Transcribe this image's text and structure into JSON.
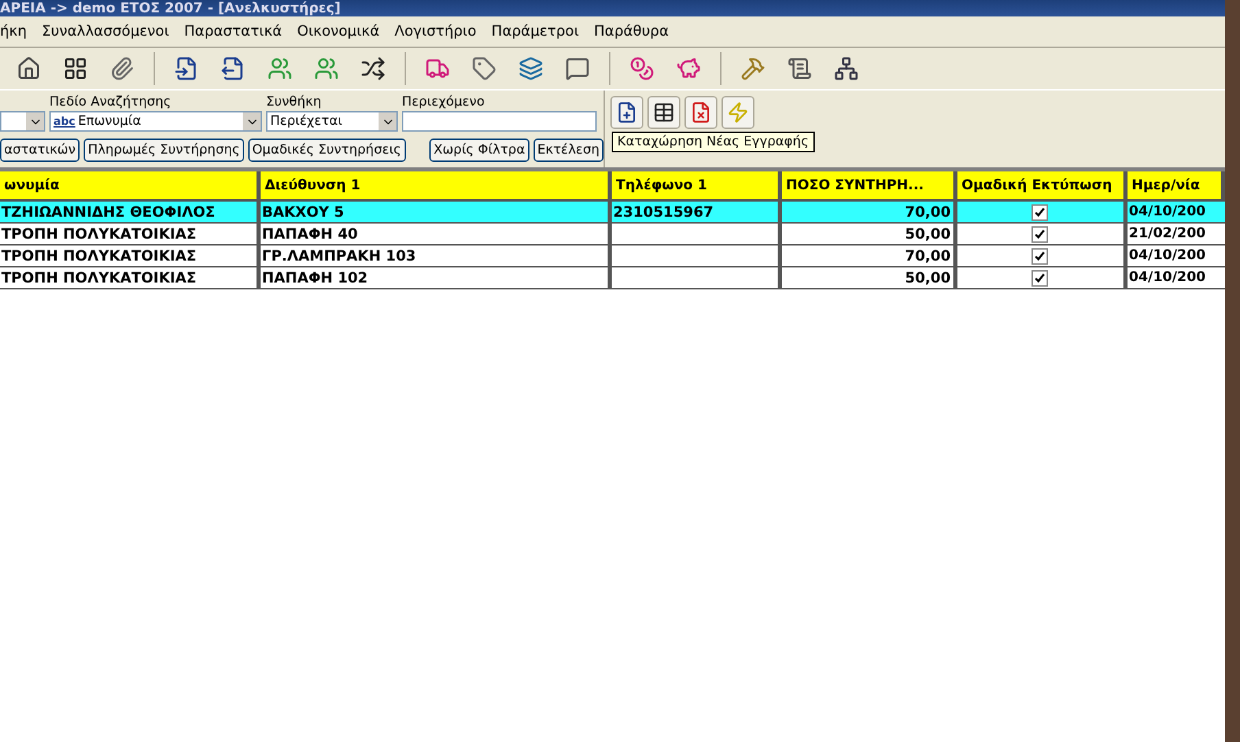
{
  "window": {
    "title": "ΑΡΕΙΑ -> demo ΕΤΟΣ 2007 - [Ανελκυστήρες]"
  },
  "menu": [
    "ήκη",
    "Συναλλασσόμενοι",
    "Παραστατικά",
    "Οικονομικά",
    "Λογιστήριο",
    "Παράμετροι",
    "Παράθυρα"
  ],
  "filter": {
    "field_label": "Πεδίο Αναζήτησης",
    "field_icon_text": "abc",
    "field_value": "Επωνυμία",
    "condition_label": "Συνθήκη",
    "condition_value": "Περιέχεται",
    "content_label": "Περιεχόμενο",
    "buttons": [
      "αστατικών",
      "Πληρωμές Συντήρησης",
      "Ομαδικές Συντηρήσεις"
    ],
    "clear_button": "Χωρίς Φίλτρα",
    "run_button": "Εκτέλεση"
  },
  "tooltip": "Καταχώρηση Νέας Εγγραφής",
  "table": {
    "columns": [
      "ωνυμία",
      "Διεύθυνση 1",
      "Τηλέφωνο 1",
      "ΠΟΣΟ ΣΥΝΤΗΡΗ...",
      "Ομαδική Εκτύπωση",
      "Ημερ/νία"
    ],
    "rows": [
      {
        "name": "ΤΖΗΙΩΑΝΝΙΔΗΣ ΘΕΟΦΙΛΟΣ",
        "address": "ΒΑΚΧΟΥ 5",
        "phone": "2310515967",
        "amount": "70,00",
        "group_print": true,
        "date": "04/10/200",
        "selected": true
      },
      {
        "name": "ΤΡΟΠΗ ΠΟΛΥΚΑΤΟΙΚΙΑΣ",
        "address": "ΠΑΠΑΦΗ 40",
        "amount": "50,00",
        "group_print": true,
        "date": "21/02/200",
        "selected": false
      },
      {
        "name": "ΤΡΟΠΗ ΠΟΛΥΚΑΤΟΙΚΙΑΣ",
        "address": "ΓΡ.ΛΑΜΠΡΑΚΗ 103",
        "amount": "70,00",
        "group_print": true,
        "date": "04/10/200",
        "selected": false
      },
      {
        "name": "ΤΡΟΠΗ ΠΟΛΥΚΑΤΟΙΚΙΑΣ",
        "address": "ΠΑΠΑΦΗ 102",
        "amount": "50,00",
        "group_print": true,
        "date": "04/10/200",
        "selected": false
      }
    ]
  }
}
